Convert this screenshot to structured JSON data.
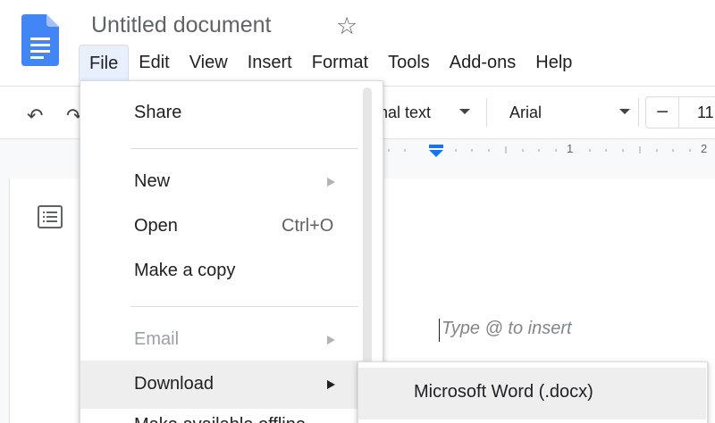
{
  "document": {
    "title": "Untitled document",
    "star_icon": "star-icon",
    "logo_icon": "docs-logo-icon"
  },
  "menubar": {
    "items": [
      "File",
      "Edit",
      "View",
      "Insert",
      "Format",
      "Tools",
      "Add-ons",
      "Help"
    ],
    "active": "File"
  },
  "toolbar": {
    "undo_icon": "undo-icon",
    "redo_icon": "redo-icon",
    "style_value": "nal text",
    "font_value": "Arial",
    "font_size_minus": "−",
    "font_size_value": "11"
  },
  "ruler": {
    "mark_1": "1",
    "mark_2": "2"
  },
  "editor": {
    "placeholder": "Type @ to insert",
    "outline_icon": "document-outline-icon"
  },
  "file_menu": {
    "share": "Share",
    "new": "New",
    "open": "Open",
    "open_shortcut": "Ctrl+O",
    "make_copy": "Make a copy",
    "email": "Email",
    "download": "Download",
    "next_partial": "Make available offline"
  },
  "download_submenu": {
    "item_1": "Microsoft Word (.docx)"
  },
  "colors": {
    "brand_blue": "#4285f4",
    "active_menu_bg": "#e8f0fe",
    "ruler_marker": "#1a73e8"
  }
}
